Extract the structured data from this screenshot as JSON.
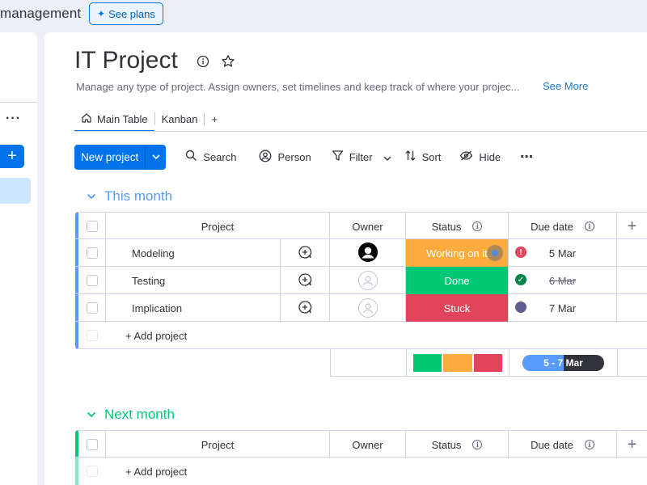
{
  "topbar": {
    "brand": "management",
    "see_plans": "See plans"
  },
  "project": {
    "title": "IT Project",
    "description": "Manage any type of project. Assign owners, set timelines and keep track of where your projec...",
    "see_more": "See More"
  },
  "tabs": [
    {
      "label": "Main Table"
    },
    {
      "label": "Kanban"
    }
  ],
  "tabs_add": "+",
  "toolbar": {
    "new_project": "New project",
    "search": "Search",
    "person": "Person",
    "filter": "Filter",
    "sort": "Sort",
    "hide": "Hide",
    "more": "⋯"
  },
  "columns": {
    "project": "Project",
    "owner": "Owner",
    "status": "Status",
    "due_date": "Due date",
    "add": "+"
  },
  "groups": [
    {
      "name": "This month",
      "color": "#579bfc",
      "rows": [
        {
          "project": "Modeling",
          "status": "Working on it",
          "status_color": "#fdab3d",
          "due": "5 Mar",
          "due_indicator": "!",
          "due_indicator_color": "#e2445c",
          "strikethrough": false
        },
        {
          "project": "Testing",
          "status": "Done",
          "status_color": "#00c875",
          "due": "6 Mar",
          "due_indicator": "✓",
          "due_indicator_color": "#00854d",
          "strikethrough": true
        },
        {
          "project": "Implication",
          "status": "Stuck",
          "status_color": "#e2445c",
          "due": "7 Mar",
          "due_indicator": "",
          "due_indicator_color": "#5559df",
          "strikethrough": false
        }
      ],
      "add_item": "+ Add project",
      "summary": {
        "status_segments": [
          {
            "color": "#00c875",
            "fraction": 0.333
          },
          {
            "color": "#fdab3d",
            "fraction": 0.333
          },
          {
            "color": "#e2445c",
            "fraction": 0.334
          }
        ],
        "timeline_label": "5 - 7 Mar",
        "timeline_progress": 0.5
      }
    },
    {
      "name": "Next month",
      "color": "#00c875",
      "rows": [],
      "add_item": "+ Add project"
    }
  ]
}
